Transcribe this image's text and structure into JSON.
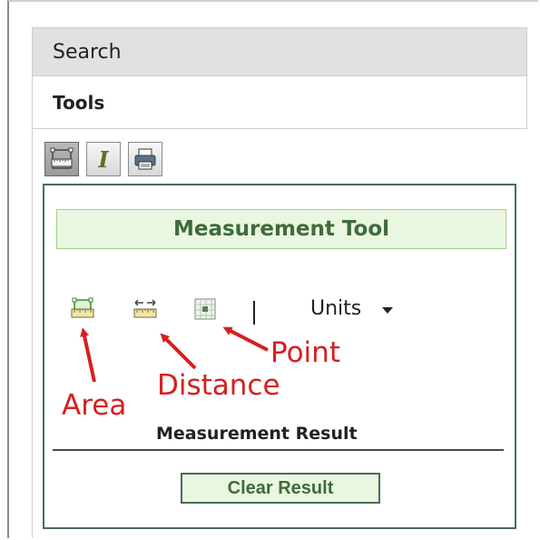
{
  "accordion": {
    "search_label": "Search",
    "tools_label": "Tools"
  },
  "toolbar": {
    "buttons": [
      {
        "name": "measure-tool-button",
        "icon": "ruler-icon",
        "active": true
      },
      {
        "name": "identify-tool-button",
        "icon": "info-i-icon",
        "glyph": "I"
      },
      {
        "name": "print-tool-button",
        "icon": "printer-icon"
      }
    ]
  },
  "measurement_tool": {
    "title": "Measurement Tool",
    "tools": [
      {
        "name": "area",
        "icon": "area-ruler-icon"
      },
      {
        "name": "distance",
        "icon": "distance-ruler-icon"
      },
      {
        "name": "point",
        "icon": "point-location-icon"
      }
    ],
    "separator": "|",
    "units_label": "Units",
    "result_label": "Measurement Result",
    "clear_button": "Clear Result"
  },
  "annotations": {
    "area": "Area",
    "distance": "Distance",
    "point": "Point",
    "color": "#d42020"
  },
  "colors": {
    "panel_border": "#4a6b5f",
    "title_background": "#eaf7e0",
    "title_text": "#3f6b3a",
    "header_background": "#e1e1e1"
  }
}
